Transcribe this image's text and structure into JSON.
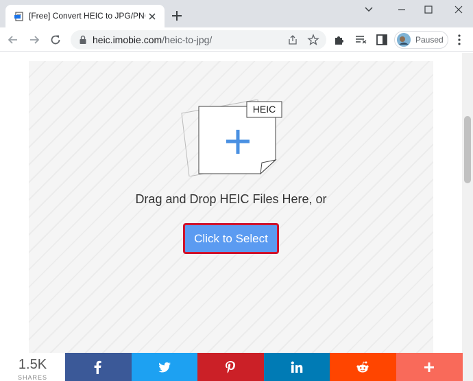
{
  "browser": {
    "tab_title": "[Free] Convert HEIC to JPG/PNG/",
    "url_host": "heic.imobie.com",
    "url_path": "/heic-to-jpg/",
    "profile_label": "Paused"
  },
  "upload": {
    "file_badge": "HEIC",
    "drop_text": "Drag and Drop HEIC Files Here, or",
    "select_button": "Click to Select"
  },
  "share": {
    "count": "1.5K",
    "count_label": "SHARES",
    "buttons": [
      {
        "icon": "facebook-icon",
        "color": "#3b5998"
      },
      {
        "icon": "twitter-icon",
        "color": "#1da1f2"
      },
      {
        "icon": "pinterest-icon",
        "color": "#cb2027"
      },
      {
        "icon": "linkedin-icon",
        "color": "#007bb5"
      },
      {
        "icon": "reddit-icon",
        "color": "#ff4500"
      },
      {
        "icon": "more-icon",
        "color": "#f96a5a"
      }
    ]
  },
  "colors": {
    "accent_button": "#5b9bf1",
    "highlight_border": "#d4142a",
    "plus_icon": "#4a90e2"
  }
}
